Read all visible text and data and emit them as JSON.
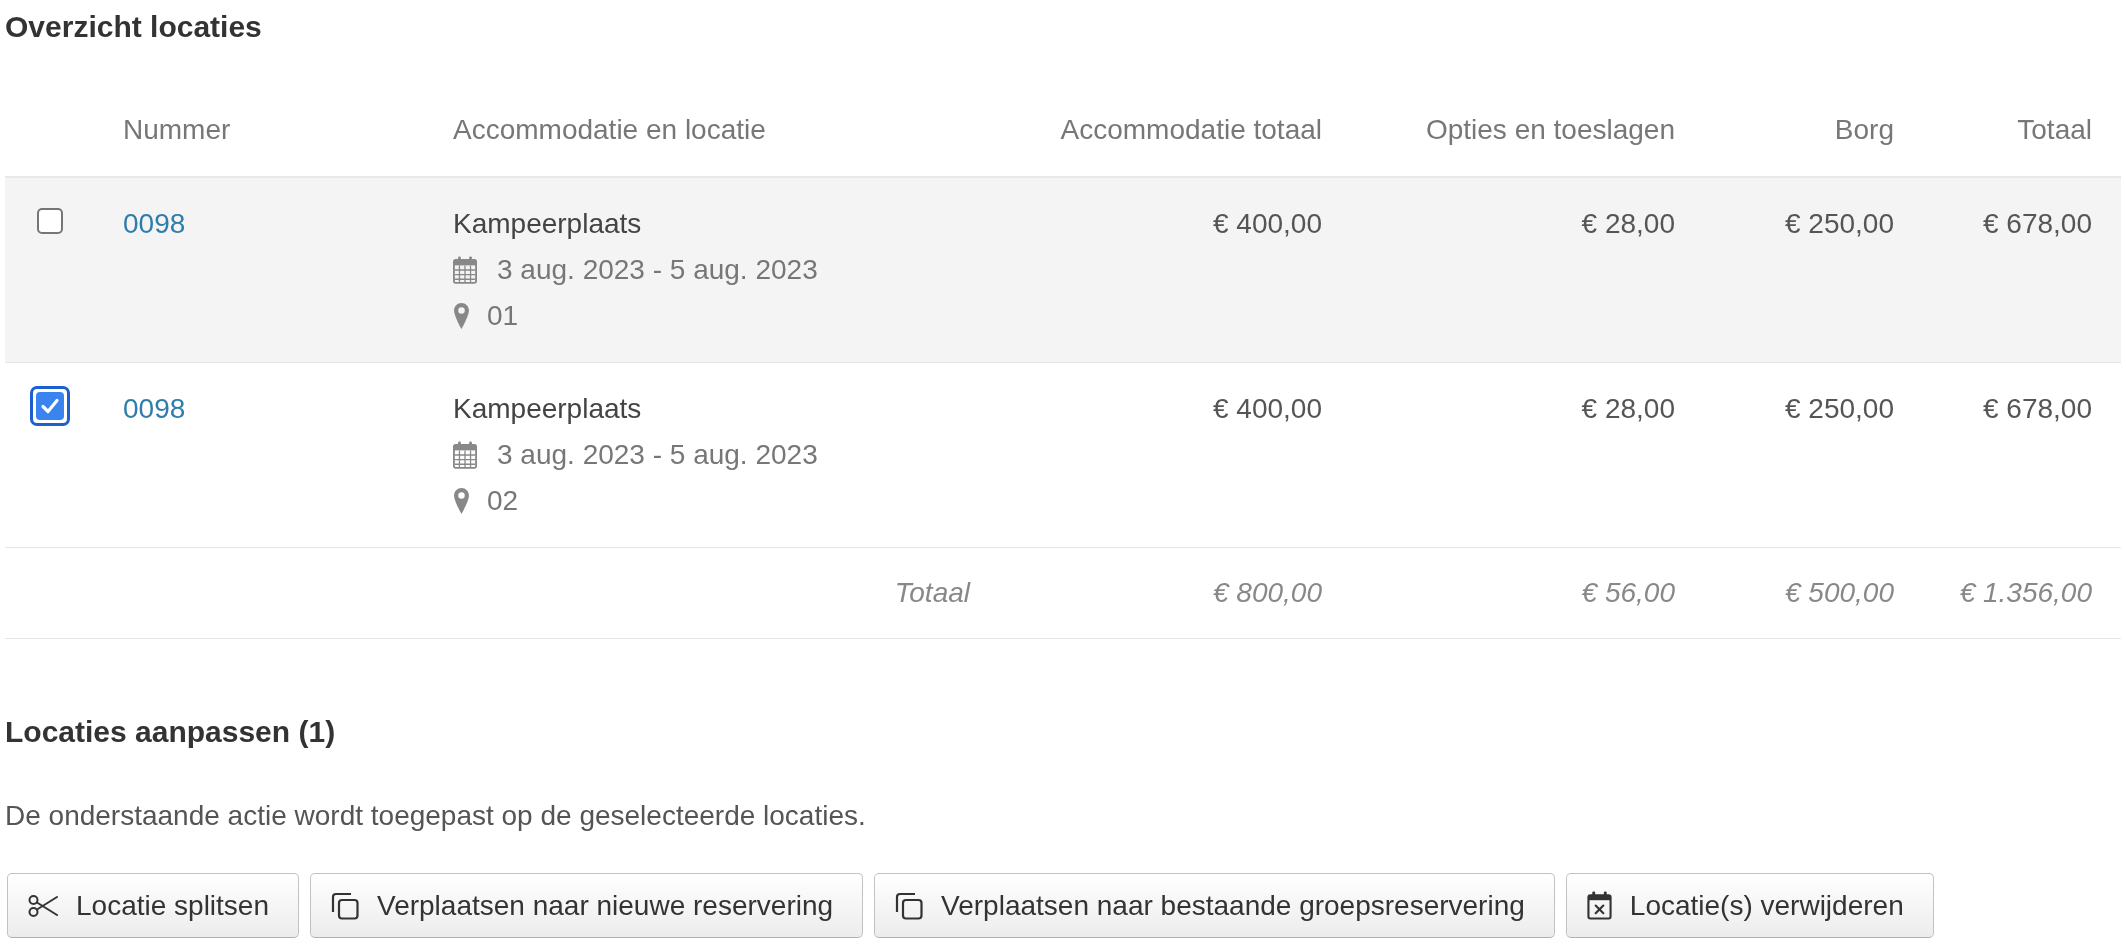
{
  "title": "Overzicht locaties",
  "table": {
    "columns": [
      "Nummer",
      "Accommodatie en locatie",
      "Accommodatie totaal",
      "Opties en toeslagen",
      "Borg",
      "Totaal"
    ],
    "rows": [
      {
        "checked": false,
        "number": "0098",
        "accommodation": "Kampeerplaats",
        "dates": "3 aug. 2023 - 5 aug. 2023",
        "location": "01",
        "amounts": [
          "€ 400,00",
          "€ 28,00",
          "€ 250,00",
          "€ 678,00"
        ]
      },
      {
        "checked": true,
        "number": "0098",
        "accommodation": "Kampeerplaats",
        "dates": "3 aug. 2023 - 5 aug. 2023",
        "location": "02",
        "amounts": [
          "€ 400,00",
          "€ 28,00",
          "€ 250,00",
          "€ 678,00"
        ]
      }
    ],
    "totals": {
      "label": "Totaal",
      "amounts": [
        "€ 800,00",
        "€ 56,00",
        "€ 500,00",
        "€ 1.356,00"
      ]
    }
  },
  "edit_section": {
    "title": "Locaties aanpassen (1)",
    "description": "De onderstaande actie wordt toegepast op de geselecteerde locaties.",
    "buttons": [
      {
        "kind": "split",
        "label": "Locatie splitsen"
      },
      {
        "kind": "move",
        "label": "Verplaatsen naar nieuwe reservering"
      },
      {
        "kind": "move",
        "label": "Verplaatsen naar bestaande groepsreservering"
      },
      {
        "kind": "delete",
        "label": "Locatie(s) verwijderen"
      }
    ]
  }
}
